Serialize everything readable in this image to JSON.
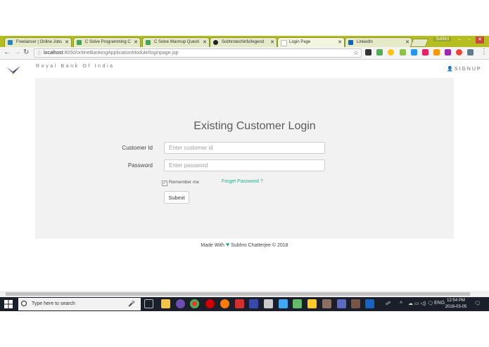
{
  "browser": {
    "tabs": [
      {
        "label": "Freelancer | Online Jobs",
        "color": "#1e88c8"
      },
      {
        "label": "C Solve Programming C",
        "color": "#3aa858"
      },
      {
        "label": "C Solve Warmup Questi",
        "color": "#3aa858"
      },
      {
        "label": "Subhrotechinfo/legend",
        "color": "#222222"
      },
      {
        "label": "Login Page",
        "color": "#e8e8e8"
      },
      {
        "label": "LinkedIn",
        "color": "#0a66c2"
      }
    ],
    "window_user": "Subhro",
    "url_host": "localhost",
    "url_rest": ":8050/onlineBankingApplicationModule/loginpage.jsp"
  },
  "page": {
    "brand_name": "Royal Bank Of India",
    "signup_label": "SIGNUP",
    "login_title": "Existing Customer Login",
    "customer_id_label": "Customer Id",
    "customer_id_placeholder": "Enter customer id",
    "password_label": "Password",
    "password_placeholder": "Enter password",
    "remember_label": "Remember me",
    "forgot_label": "Forget Password ?",
    "submit_label": "Submit",
    "footer_prefix": "Made With",
    "footer_suffix": "Subhro Chatterjee © 2018",
    "accent_color": "#2eaa8c"
  },
  "taskbar": {
    "search_placeholder": "Type here to search",
    "language": "ENG",
    "time": "12:54 PM",
    "date": "2018-03-05"
  }
}
